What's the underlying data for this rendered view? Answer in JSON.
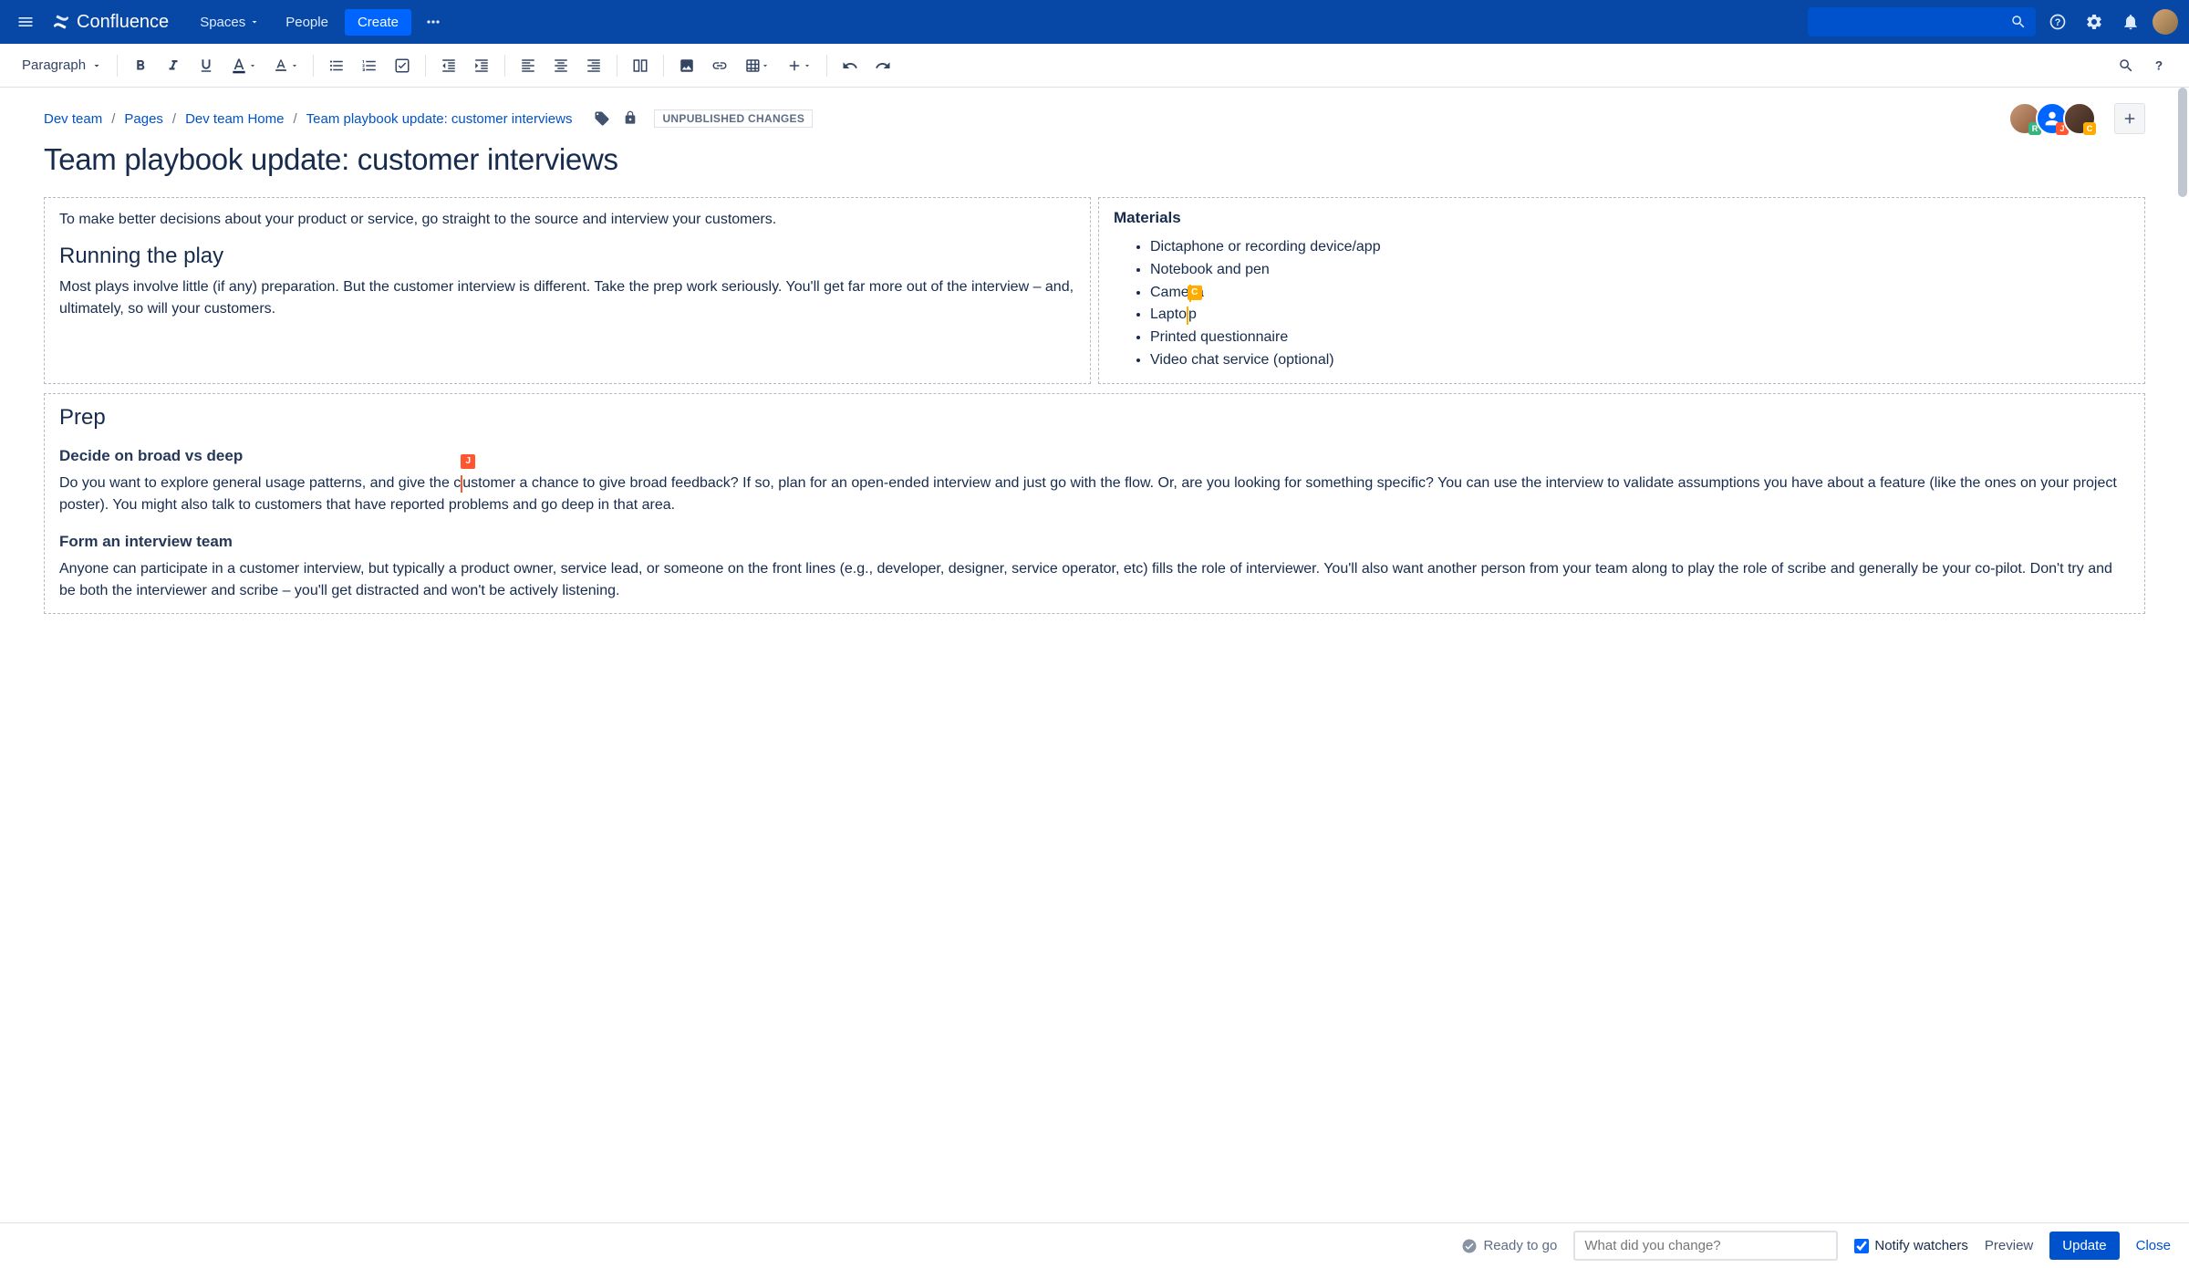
{
  "brand": "Confluence",
  "nav": {
    "spaces": "Spaces",
    "people": "People",
    "create": "Create"
  },
  "toolbar": {
    "style_dropdown": "Paragraph"
  },
  "breadcrumbs": [
    "Dev team",
    "Pages",
    "Dev team Home",
    "Team playbook update: customer interviews"
  ],
  "status_badge": "UNPUBLISHED CHANGES",
  "collaborators": [
    {
      "bg": "linear-gradient(135deg,#c89878,#8b5a3c)",
      "badge_letter": "R",
      "badge_color": "#36B37E"
    },
    {
      "bg": "#0065FF",
      "badge_letter": "J",
      "badge_color": "#FF5630",
      "is_icon": true
    },
    {
      "bg": "linear-gradient(135deg,#6b4a3a,#3a2820)",
      "badge_letter": "C",
      "badge_color": "#FFAB00"
    }
  ],
  "page_title": "Team playbook update: customer interviews",
  "intro_text": "To make better decisions about your product or service, go straight to the source and interview your customers.",
  "section_running_h": "Running the play",
  "section_running_p": "Most plays involve little (if any) preparation. But the customer interview is different. Take the prep work seriously. You'll get far more out of the interview – and, ultimately, so will your customers.",
  "materials_title": "Materials",
  "materials": [
    "Dictaphone or recording device/app",
    "Notebook and pen",
    "Camera",
    "Laptop",
    "Printed questionnaire",
    "Video chat service (optional)"
  ],
  "prep_h": "Prep",
  "prep_s1_h": "Decide on broad vs deep",
  "prep_s1_p": "Do you want to explore general usage patterns, and give the customer a chance to give broad feedback? If so, plan for an open-ended interview and just go with the flow. Or, are you looking for something specific? You can use the interview to validate assumptions you have about a feature (like the ones on your project poster). You might also talk to customers that have reported problems and go deep in that area.",
  "prep_s2_h": "Form an interview team",
  "prep_s2_p": "Anyone can participate in a customer interview, but typically a product owner, service lead, or someone on the front lines (e.g., developer, designer, service operator, etc) fills the role of interviewer. You'll also want another person from your team along to play the role of scribe and generally be your co-pilot. Don't try and be both the interviewer and scribe – you'll get distracted and won't be actively listening.",
  "cursor_j": {
    "letter": "J",
    "color": "#FF5630"
  },
  "cursor_c": {
    "letter": "C",
    "color": "#FFAB00"
  },
  "footer": {
    "ready": "Ready to go",
    "change_placeholder": "What did you change?",
    "notify": "Notify watchers",
    "preview": "Preview",
    "update": "Update",
    "close": "Close"
  }
}
